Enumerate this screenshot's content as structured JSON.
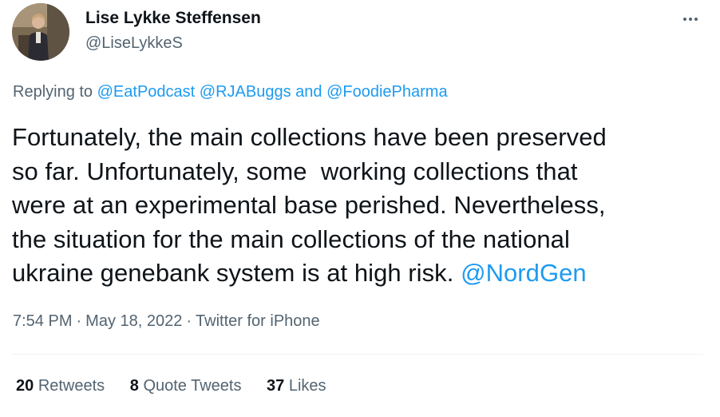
{
  "author": {
    "display_name": "Lise Lykke Steffensen",
    "handle": "@LiseLykkeS",
    "avatar_icon": "profile-photo-icon"
  },
  "more_icon": "more-options-icon",
  "replying": {
    "prefix": "Replying to",
    "mention_1": "@EatPodcast",
    "mention_2": "@RJABuggs",
    "connector": "and",
    "mention_3": "@FoodiePharma"
  },
  "tweet": {
    "line_1": "Fortunately, the main collections have been preserved",
    "line_2": "so far. Unfortunately, some  working collections that",
    "line_3": "were at an experimental base perished. Nevertheless,",
    "line_4": "the situation for the main collections of the national",
    "line_5": "ukraine genebank system is at high risk. ",
    "mention": "@NordGen"
  },
  "meta": {
    "time": "7:54 PM",
    "separator": "·",
    "date": "May 18, 2022",
    "source": "Twitter for iPhone"
  },
  "stats": {
    "retweets_count": "20",
    "retweets_label": "Retweets",
    "quotes_count": "8",
    "quotes_label": "Quote Tweets",
    "likes_count": "37",
    "likes_label": "Likes"
  },
  "colors": {
    "text": "#0f1419",
    "secondary": "#536471",
    "link": "#1d9bf0",
    "divider": "#eff3f4"
  }
}
